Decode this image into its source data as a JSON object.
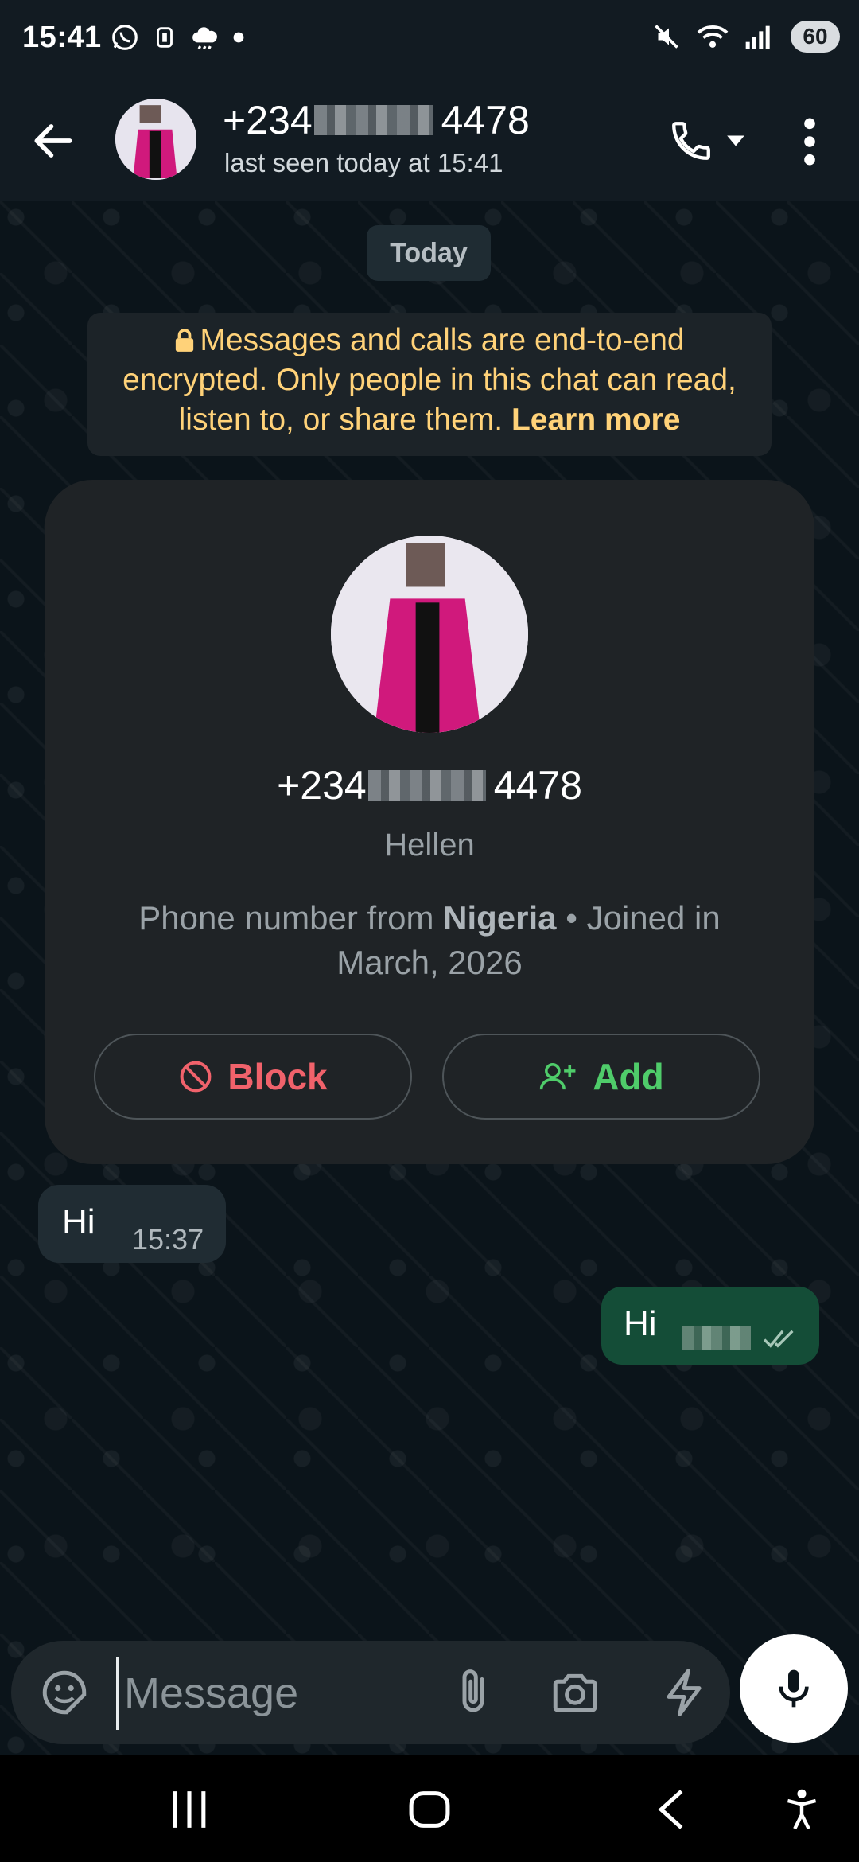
{
  "status_bar": {
    "time": "15:41",
    "battery": "60",
    "icons_left": [
      "whatsapp-icon",
      "bluetooth-device-icon",
      "weather-cloud-icon",
      "dot-icon"
    ],
    "icons_right": [
      "mute-icon",
      "wifi-icon",
      "signal-icon"
    ]
  },
  "header": {
    "name_prefix": "+234",
    "name_suffix": "4478",
    "status": "last seen today at 15:41"
  },
  "chat": {
    "date_chip": "Today",
    "encryption_text": "Messages and calls are end-to-end encrypted. Only people in this chat can read, listen to, or share them.",
    "encryption_link": "Learn more"
  },
  "contact_card": {
    "number_prefix": "+234",
    "number_suffix": "4478",
    "name": "Hellen",
    "info_prefix": "Phone number from ",
    "country": "Nigeria",
    "info_suffix": " • Joined in March, 2026",
    "block_label": "Block",
    "add_label": "Add"
  },
  "messages": [
    {
      "direction": "incoming",
      "text": "Hi",
      "time": "15:37"
    },
    {
      "direction": "outgoing",
      "text": "Hi",
      "status": "read"
    }
  ],
  "input": {
    "placeholder": "Message"
  },
  "colors": {
    "background": "#0b141a",
    "header": "#121b22",
    "incoming_bubble": "#202c33",
    "outgoing_bubble": "#144d37",
    "block": "#f0626b",
    "add": "#4fcc6a",
    "encryption_text": "#ffd279"
  }
}
